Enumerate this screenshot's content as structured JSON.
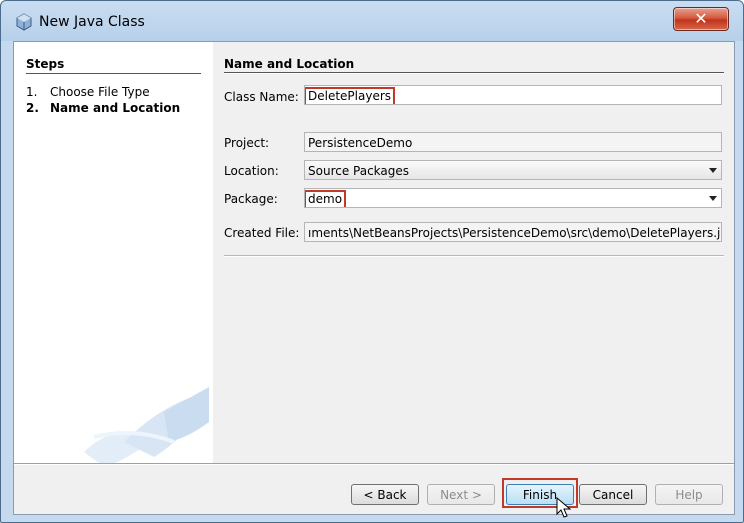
{
  "window": {
    "title": "New Java Class",
    "close_glyph": "✕"
  },
  "steps": {
    "heading": "Steps",
    "items": [
      {
        "num": "1.",
        "label": "Choose File Type"
      },
      {
        "num": "2.",
        "label": "Name and Location"
      }
    ]
  },
  "form": {
    "heading": "Name and Location",
    "class_name_label": "Class Name:",
    "class_name_value": "DeletePlayers",
    "project_label": "Project:",
    "project_value": "PersistenceDemo",
    "location_label": "Location:",
    "location_value": "Source Packages",
    "package_label": "Package:",
    "package_value": "demo",
    "created_file_label": "Created File:",
    "created_file_value": "ıments\\NetBeansProjects\\PersistenceDemo\\src\\demo\\DeletePlayers.java"
  },
  "buttons": {
    "back": "< Back",
    "next": "Next >",
    "finish": "Finish",
    "cancel": "Cancel",
    "help": "Help"
  },
  "colors": {
    "highlight": "#c0392b",
    "title_bg": "#b7d0ea"
  },
  "icons": {
    "title": "java-class-cube-icon",
    "close": "close-icon",
    "combo": "chevron-down-icon",
    "cursor": "mouse-pointer-icon"
  }
}
